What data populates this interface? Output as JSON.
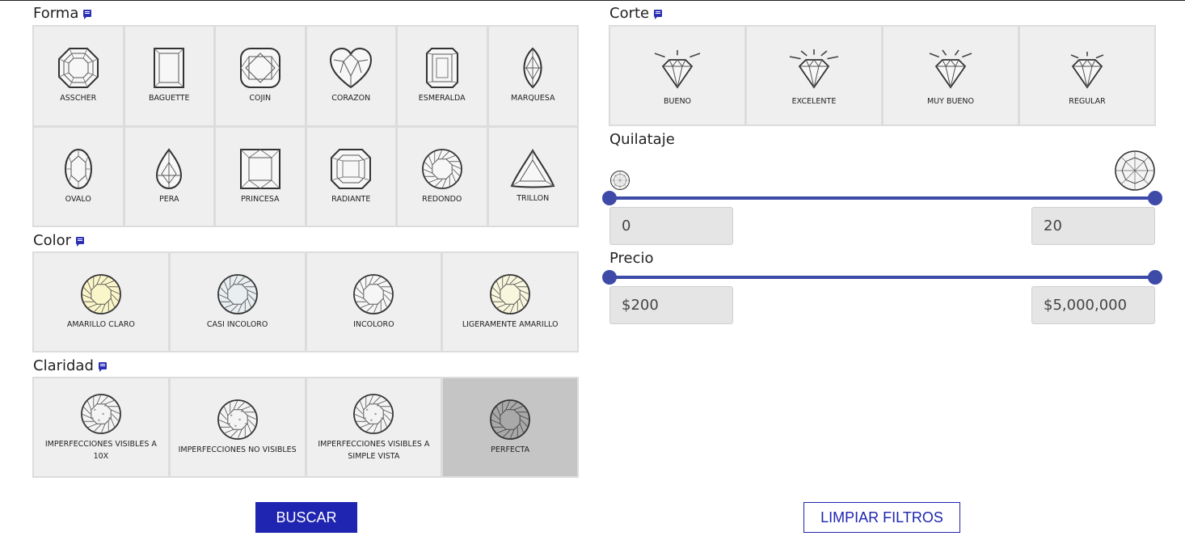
{
  "sections": {
    "forma": "Forma",
    "color": "Color",
    "claridad": "Claridad",
    "corte": "Corte",
    "quilataje": "Quilataje",
    "precio": "Precio"
  },
  "shapes": [
    {
      "label": "ASSCHER",
      "icon": "asscher-icon"
    },
    {
      "label": "BAGUETTE",
      "icon": "baguette-icon"
    },
    {
      "label": "COJIN",
      "icon": "cushion-icon"
    },
    {
      "label": "CORAZON",
      "icon": "heart-icon"
    },
    {
      "label": "ESMERALDA",
      "icon": "emerald-icon"
    },
    {
      "label": "MARQUESA",
      "icon": "marquise-icon"
    },
    {
      "label": "OVALO",
      "icon": "oval-icon"
    },
    {
      "label": "PERA",
      "icon": "pear-icon"
    },
    {
      "label": "PRINCESA",
      "icon": "princess-icon"
    },
    {
      "label": "RADIANTE",
      "icon": "radiant-icon"
    },
    {
      "label": "REDONDO",
      "icon": "round-icon"
    },
    {
      "label": "TRILLON",
      "icon": "trillion-icon"
    }
  ],
  "colors": [
    {
      "label": "AMARILLO CLARO",
      "icon": "round-diamond-icon",
      "tint": "#fbf6c9"
    },
    {
      "label": "CASI INCOLORO",
      "icon": "round-diamond-icon",
      "tint": "#e9eef0"
    },
    {
      "label": "INCOLORO",
      "icon": "round-diamond-icon",
      "tint": "#f6f6f6"
    },
    {
      "label": "LIGERAMENTE AMARILLO",
      "icon": "round-diamond-icon",
      "tint": "#f8f6dc"
    }
  ],
  "clarity": [
    {
      "label": "IMPERFECCIONES VISIBLES A 10X",
      "icon": "diamond-inclusions-icon",
      "selected": false
    },
    {
      "label": "IMPERFECCIONES NO VISIBLES",
      "icon": "diamond-inclusions-icon",
      "selected": false
    },
    {
      "label": "IMPERFECCIONES VISIBLES A SIMPLE VISTA",
      "icon": "diamond-inclusions-icon",
      "selected": false
    },
    {
      "label": "PERFECTA",
      "icon": "diamond-flawless-icon",
      "selected": true
    }
  ],
  "cuts": [
    {
      "label": "BUENO",
      "icon": "sparkle-diamond-icon"
    },
    {
      "label": "EXCELENTE",
      "icon": "sparkle-diamond-icon"
    },
    {
      "label": "MUY BUENO",
      "icon": "sparkle-diamond-icon"
    },
    {
      "label": "REGULAR",
      "icon": "sparkle-diamond-icon"
    }
  ],
  "carat": {
    "min": "0",
    "max": "20"
  },
  "price": {
    "min": "$200",
    "max": "$5,000,000"
  },
  "buttons": {
    "search": "BUSCAR",
    "clear": "LIMPIAR FILTROS"
  },
  "colors_ui": {
    "accent": "#1f25b0",
    "slider": "#3d4aa8",
    "tile": "#efefef",
    "selected": "#c5c5c5"
  }
}
